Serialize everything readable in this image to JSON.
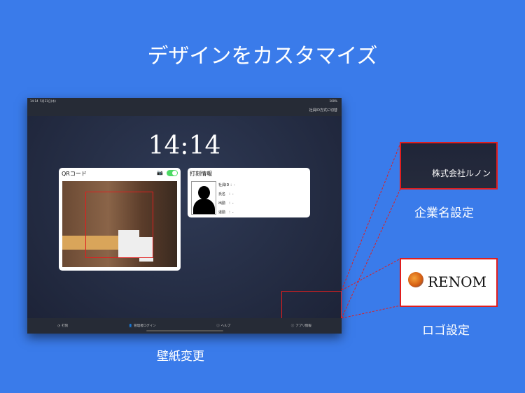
{
  "title": "デザインをカスタマイズ",
  "status": {
    "time": "14:14",
    "date": "5月21日(木)",
    "battery": "100%"
  },
  "header": {
    "switch_label": "社員ID方式に切替"
  },
  "clock": "14:14",
  "qr_card": {
    "title": "QRコード"
  },
  "info_card": {
    "title": "打刻情報",
    "rows": [
      {
        "label": "社員ID",
        "value": "：-"
      },
      {
        "label": "氏名",
        "value": "：-"
      },
      {
        "label": "出勤",
        "value": "：-"
      },
      {
        "label": "退勤",
        "value": "：-"
      }
    ]
  },
  "tabs": [
    {
      "icon": "clock-icon",
      "label": "打刻"
    },
    {
      "icon": "person-icon",
      "label": "管理者ログイン"
    },
    {
      "icon": "help-icon",
      "label": "ヘルプ"
    },
    {
      "icon": "info-icon",
      "label": "アプリ情報"
    }
  ],
  "callouts": {
    "company_sample": "株式会社ルノン",
    "company_label": "企業名設定",
    "logo_text": "RENOM",
    "logo_label": "ロゴ設定",
    "wallpaper_label": "壁紙変更"
  }
}
